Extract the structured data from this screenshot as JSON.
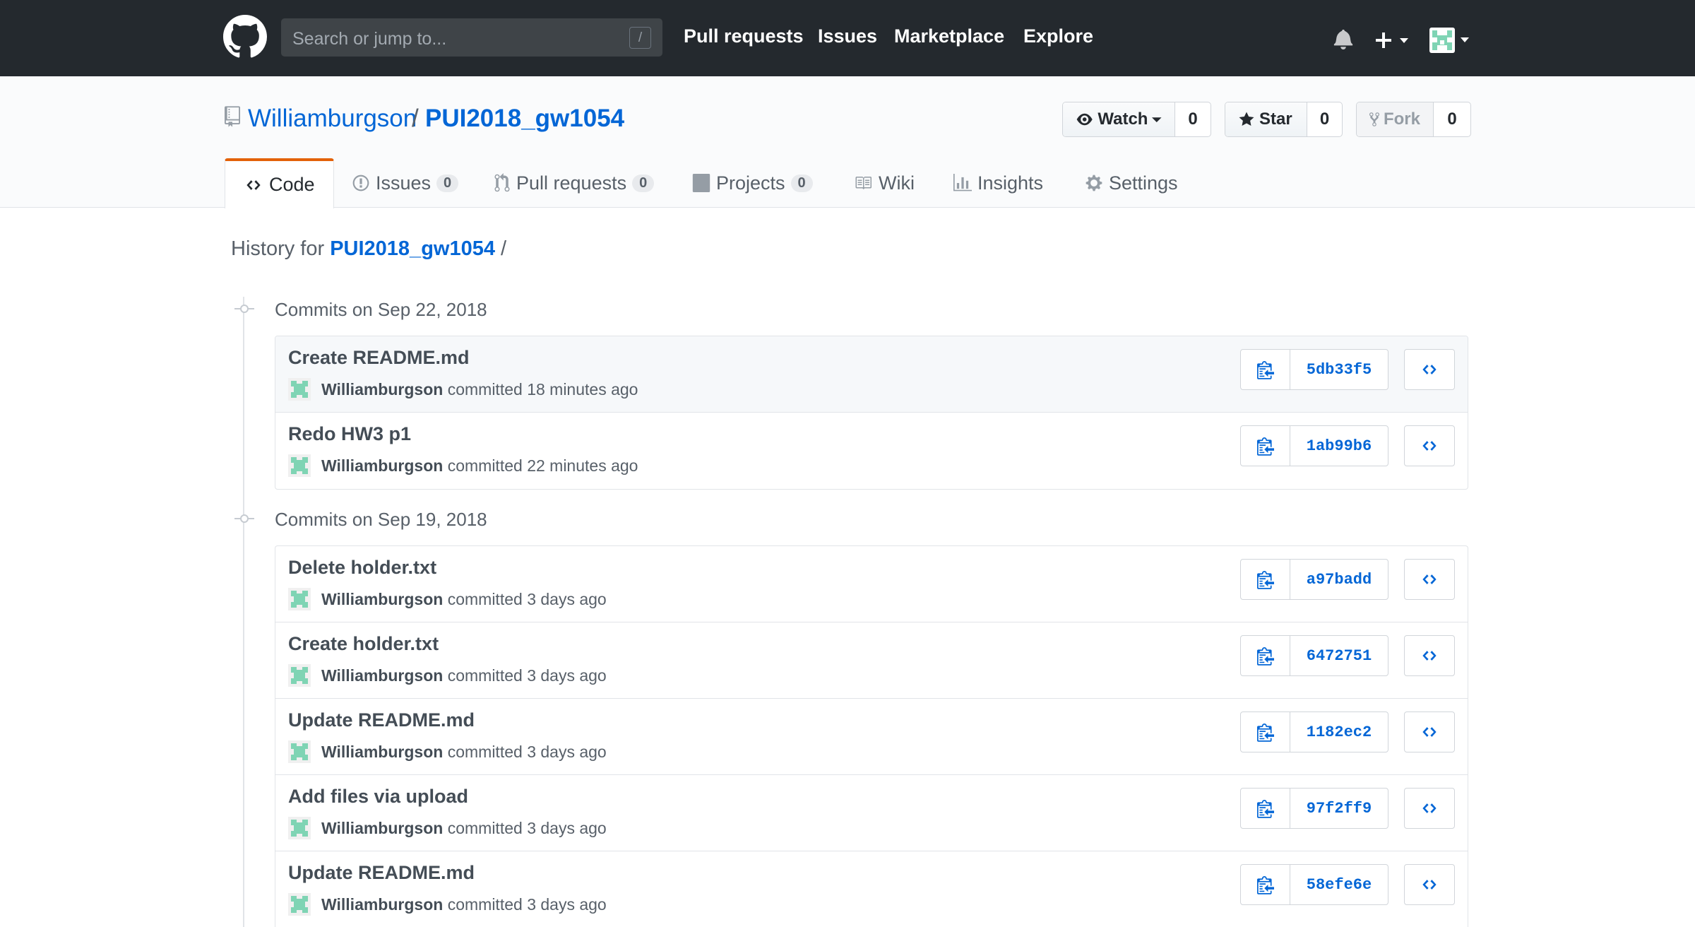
{
  "header": {
    "search_placeholder": "Search or jump to...",
    "search_shortcut": "/",
    "nav": [
      "Pull requests",
      "Issues",
      "Marketplace",
      "Explore"
    ]
  },
  "repo": {
    "owner": "Williamburgson",
    "separator": "/",
    "name": "PUI2018_gw1054",
    "watch_label": "Watch",
    "watch_count": "0",
    "star_label": "Star",
    "star_count": "0",
    "fork_label": "Fork",
    "fork_count": "0"
  },
  "tabs": {
    "code": "Code",
    "issues": "Issues",
    "issues_count": "0",
    "pulls": "Pull requests",
    "pulls_count": "0",
    "projects": "Projects",
    "projects_count": "0",
    "wiki": "Wiki",
    "insights": "Insights",
    "settings": "Settings"
  },
  "history": {
    "prefix": "History for",
    "repo": "PUI2018_gw1054",
    "suffix": "/"
  },
  "groups": [
    {
      "title": "Commits on Sep 22, 2018",
      "commits": [
        {
          "message": "Create README.md",
          "author": "Williamburgson",
          "verb": "committed",
          "time": "18 minutes ago",
          "sha": "5db33f5"
        },
        {
          "message": "Redo HW3 p1",
          "author": "Williamburgson",
          "verb": "committed",
          "time": "22 minutes ago",
          "sha": "1ab99b6"
        }
      ]
    },
    {
      "title": "Commits on Sep 19, 2018",
      "commits": [
        {
          "message": "Delete holder.txt",
          "author": "Williamburgson",
          "verb": "committed",
          "time": "3 days ago",
          "sha": "a97badd"
        },
        {
          "message": "Create holder.txt",
          "author": "Williamburgson",
          "verb": "committed",
          "time": "3 days ago",
          "sha": "6472751"
        },
        {
          "message": "Update README.md",
          "author": "Williamburgson",
          "verb": "committed",
          "time": "3 days ago",
          "sha": "1182ec2"
        },
        {
          "message": "Add files via upload",
          "author": "Williamburgson",
          "verb": "committed",
          "time": "3 days ago",
          "sha": "97f2ff9"
        },
        {
          "message": "Update README.md",
          "author": "Williamburgson",
          "verb": "committed",
          "time": "3 days ago",
          "sha": "58efe6e"
        }
      ]
    }
  ],
  "colors": {
    "header_bg": "#24292e",
    "link": "#0366d6",
    "tab_accent": "#e36209",
    "avatar": "#7fd4b4"
  }
}
